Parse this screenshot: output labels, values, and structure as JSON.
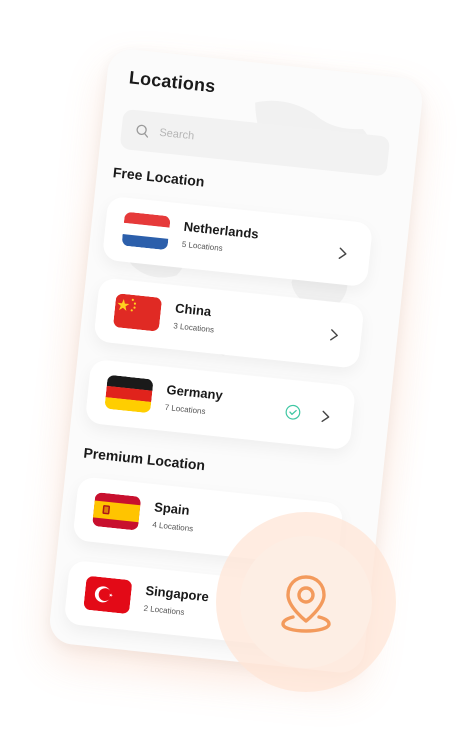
{
  "header": {
    "title": "Locations"
  },
  "search": {
    "placeholder": "Search"
  },
  "free_section": {
    "title": "Free Location",
    "items": [
      {
        "name": "Netherlands",
        "sublabel": "5 Locations",
        "flag": "netherlands-flag",
        "selected": false
      },
      {
        "name": "China",
        "sublabel": "3 Locations",
        "flag": "china-flag",
        "selected": false
      },
      {
        "name": "Germany",
        "sublabel": "7 Locations",
        "flag": "germany-flag",
        "selected": true
      }
    ]
  },
  "premium_section": {
    "title": "Premium Location",
    "items": [
      {
        "name": "Spain",
        "sublabel": "4 Locations",
        "flag": "spain-flag"
      },
      {
        "name": "Singapore",
        "sublabel": "2 Locations",
        "flag": "turkey-flag"
      }
    ]
  },
  "colors": {
    "accent": "#f39a5c",
    "check": "#3fc7a3",
    "card_bg": "#ffffff",
    "phone_bg": "#fbfbfb"
  },
  "icons": [
    "search-icon",
    "chevron-right-icon",
    "check-circle-icon",
    "location-pin-icon"
  ]
}
